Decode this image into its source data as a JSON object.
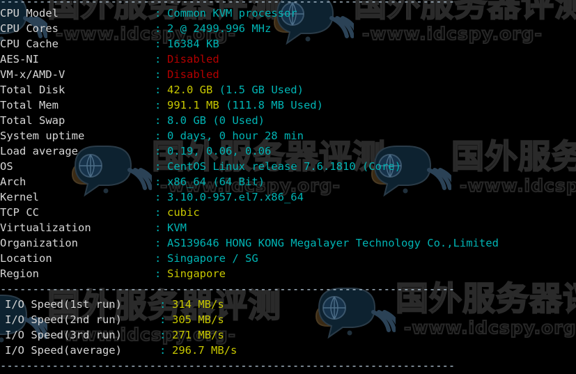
{
  "terminal": {
    "colors": {
      "background": "#000000",
      "label": "#d6d6d6",
      "cyan": "#00b4b4",
      "yellow": "#c8c800",
      "red": "#b40000",
      "divider": "#bfd4e4"
    },
    "divider_top": "----------------------------------------------------------------------",
    "divider_mid": "----------------------------------------------------------------------",
    "divider_bottom": "----------------------------------------------------------------------",
    "colon": ":",
    "sysinfo": [
      {
        "label": "CPU Model",
        "value": "Common KVM processor",
        "color": "cyan"
      },
      {
        "label": "CPU Cores",
        "value": "2 @ 2499.996 MHz",
        "color": "cyan"
      },
      {
        "label": "CPU Cache",
        "value": "16384 KB",
        "color": "cyan"
      },
      {
        "label": "AES-NI",
        "value": "Disabled",
        "color": "red"
      },
      {
        "label": "VM-x/AMD-V",
        "value": "Disabled",
        "color": "red"
      },
      {
        "label": "Total Disk",
        "value": "42.0 GB",
        "value2": " (1.5 GB Used)",
        "color": "yellow",
        "color2": "cyan"
      },
      {
        "label": "Total Mem",
        "value": "991.1 MB",
        "value2": " (111.8 MB Used)",
        "color": "yellow",
        "color2": "cyan"
      },
      {
        "label": "Total Swap",
        "value": "8.0 GB (0 Used)",
        "color": "cyan"
      },
      {
        "label": "System uptime",
        "value": "0 days, 0 hour 28 min",
        "color": "cyan"
      },
      {
        "label": "Load average",
        "value": "0.19, 0.06, 0.06",
        "color": "cyan"
      },
      {
        "label": "OS",
        "value": "CentOS Linux release 7.6.1810 (Core)",
        "color": "cyan"
      },
      {
        "label": "Arch",
        "value": "x86_64 (64 Bit)",
        "color": "cyan"
      },
      {
        "label": "Kernel",
        "value": "3.10.0-957.el7.x86_64",
        "color": "cyan"
      },
      {
        "label": "TCP CC",
        "value": "cubic",
        "color": "yellow"
      },
      {
        "label": "Virtualization",
        "value": "KVM",
        "color": "cyan"
      },
      {
        "label": "Organization",
        "value": "AS139646 HONG KONG Megalayer Technology Co.,Limited",
        "color": "cyan"
      },
      {
        "label": "Location",
        "value": "Singapore / SG",
        "color": "cyan"
      },
      {
        "label": "Region",
        "value": "Singapore",
        "color": "yellow"
      }
    ],
    "iospeed": [
      {
        "label": "I/O Speed(1st run)",
        "value": "314 MB/s",
        "color": "yellow"
      },
      {
        "label": "I/O Speed(2nd run)",
        "value": "305 MB/s",
        "color": "yellow"
      },
      {
        "label": "I/O Speed(3rd run)",
        "value": "271 MB/s",
        "color": "yellow"
      },
      {
        "label": "I/O Speed(average)",
        "value": "296.7 MB/s",
        "color": "yellow"
      }
    ]
  },
  "watermark": {
    "text_cn": "国外服务器评测",
    "text_url": "-www.idcspy.org-",
    "logo_name": "globe-speech-bubble-logo"
  }
}
